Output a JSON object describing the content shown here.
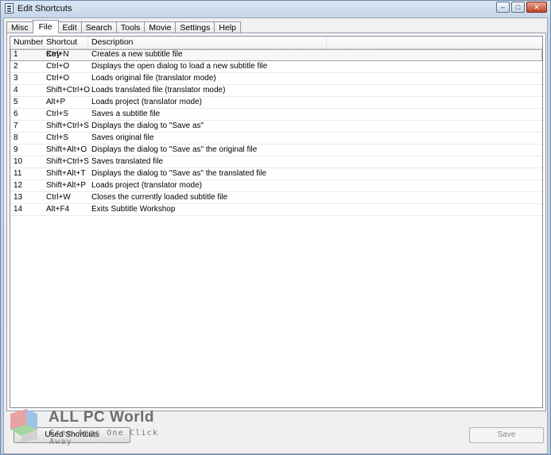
{
  "window": {
    "title": "Edit Shortcuts",
    "controls": {
      "minimize": "–",
      "maximize": "□",
      "close": "✕"
    }
  },
  "tabs": [
    {
      "label": "Misc",
      "active": false
    },
    {
      "label": "File",
      "active": true
    },
    {
      "label": "Edit",
      "active": false
    },
    {
      "label": "Search",
      "active": false
    },
    {
      "label": "Tools",
      "active": false
    },
    {
      "label": "Movie",
      "active": false
    },
    {
      "label": "Settings",
      "active": false
    },
    {
      "label": "Help",
      "active": false
    }
  ],
  "table": {
    "headers": [
      "Number",
      "Shortcut Key",
      "Description"
    ],
    "rows": [
      [
        "1",
        "Ctrl+N",
        "Creates a new subtitle file"
      ],
      [
        "2",
        "Ctrl+O",
        "Displays the open dialog to load a new subtitle file"
      ],
      [
        "3",
        "Ctrl+O",
        "Loads original file (translator mode)"
      ],
      [
        "4",
        "Shift+Ctrl+O",
        "Loads translated file (translator mode)"
      ],
      [
        "5",
        "Alt+P",
        "Loads project (translator mode)"
      ],
      [
        "6",
        "Ctrl+S",
        "Saves a subtitle file"
      ],
      [
        "7",
        "Shift+Ctrl+S",
        "Displays the dialog to \"Save as\""
      ],
      [
        "8",
        "Ctrl+S",
        "Saves original file"
      ],
      [
        "9",
        "Shift+Alt+O",
        "Displays the dialog to \"Save as\" the original file"
      ],
      [
        "10",
        "Shift+Ctrl+S",
        "Saves translated file"
      ],
      [
        "11",
        "Shift+Alt+T",
        "Displays the dialog to \"Save as\" the translated file"
      ],
      [
        "12",
        "Shift+Alt+P",
        "Loads project (translator mode)"
      ],
      [
        "13",
        "Ctrl+W",
        "Closes the currently loaded subtitle file"
      ],
      [
        "14",
        "Alt+F4",
        "Exits Subtitle Workshop"
      ]
    ],
    "selected_row": 0
  },
  "buttons": {
    "used_shortcuts": "Used Shortcuts",
    "save": "Save"
  },
  "watermark": {
    "title": "ALL PC World",
    "subtitle": "Free Apps One Click Away"
  },
  "colors": {
    "titlebar": "#c7d7ea",
    "close_button": "#c2432a",
    "panel_bg": "#ffffff",
    "window_bg": "#f0f0f0"
  }
}
